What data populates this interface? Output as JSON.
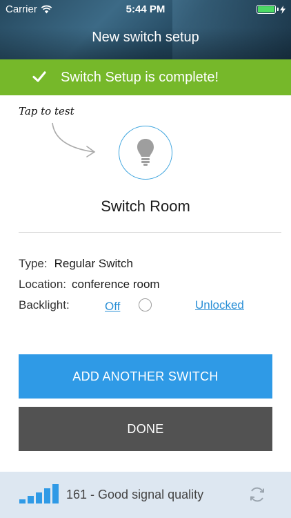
{
  "status_bar": {
    "carrier": "Carrier",
    "time": "5:44 PM",
    "icons": [
      "wifi-icon",
      "battery-icon",
      "charging-bolt-icon"
    ]
  },
  "nav": {
    "title": "New switch setup"
  },
  "banner": {
    "message": "Switch Setup is complete!",
    "color": "#76b82a",
    "icon": "checkmark-icon"
  },
  "hint": {
    "text": "Tap to test"
  },
  "switch": {
    "name": "Switch Room",
    "test_icon": "light-bulb-icon",
    "accent": "#3aa3de"
  },
  "details": {
    "type_label": "Type:",
    "type_value": "Regular Switch",
    "location_label": "Location:",
    "location_value": "conference room",
    "backlight_label": "Backlight:",
    "backlight_off": "Off",
    "backlight_lock": "Unlocked"
  },
  "buttons": {
    "add_label": "ADD ANOTHER SWITCH",
    "add_color": "#2f9ae6",
    "done_label": "DONE",
    "done_color": "#525252"
  },
  "footer": {
    "signal_text": "161 - Good signal quality",
    "signal_icon": "signal-bars-icon",
    "refresh_icon": "refresh-icon"
  }
}
